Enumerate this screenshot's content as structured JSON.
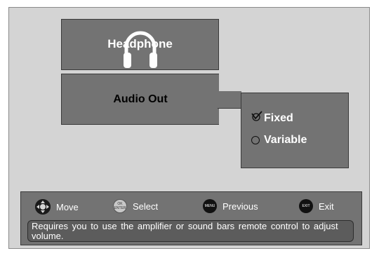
{
  "menu": {
    "title": "Headphone",
    "item_label": "Audio Out",
    "options": [
      {
        "label": "Fixed",
        "selected": true
      },
      {
        "label": "Variable",
        "selected": false
      }
    ]
  },
  "hints": [
    {
      "key": "dpad-icon",
      "label": "Move"
    },
    {
      "key": "ok-icon",
      "key_text": "OK ENTER",
      "label": "Select"
    },
    {
      "key": "menu-icon",
      "key_text": "MENU",
      "label": "Previous"
    },
    {
      "key": "exit-icon",
      "key_text": "EXIT",
      "label": "Exit"
    }
  ],
  "description": "Requires you to use the amplifier or sound bars remote control to adjust volume.",
  "colors": {
    "background": "#d4d4d4",
    "panel": "#737373",
    "text": "#ffffff"
  }
}
